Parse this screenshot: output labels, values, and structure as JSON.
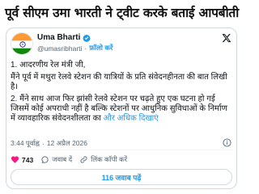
{
  "headline": "पूर्व सीएम उमा भारती ने ट्वीट करके बताई आपबीती",
  "tweet": {
    "author_name": "Uma Bharti",
    "handle": "@umasribharti",
    "separator": "·",
    "follow_label": "फ़ॉलो करें",
    "text_paragraphs": [
      "1. आदरणीय रेल मंत्री जी,",
      "मैंने पूर्व में मथुरा रेलवे स्टेशन की यात्रियों के प्रति संवेदनहीनता की बात लिखी है।",
      "2. मैंने साथ आज फिर झांसी रेलवे स्टेशन पर चढ़ते हुए एक घटना हो गई जिसमें कोई अपराधी नहीं है बल्कि स्टेशनों पर आधुनिक सुविधाओं के निर्माण में व्यावहारिक संवेदनशीलता का"
    ],
    "show_more": "और अधिक दिखाएं",
    "time": "3:44 पूर्वाह्न",
    "date": "12 अप्रैल 2026",
    "likes": "743",
    "reply_label": "जवाब दें",
    "copy_link_label": "लिंक कॉपी करें",
    "replies_button": "116 जवाब पढ़ें"
  },
  "colors": {
    "accent": "#1d9bf0",
    "like_red": "#f91880",
    "text": "#0f1419",
    "muted": "#536471",
    "border": "#cfd9de"
  },
  "icons": [
    "india-flag-avatar",
    "verified-badge-icon",
    "x-logo-icon",
    "info-icon",
    "heart-icon",
    "reply-bubble-icon",
    "link-icon"
  ]
}
